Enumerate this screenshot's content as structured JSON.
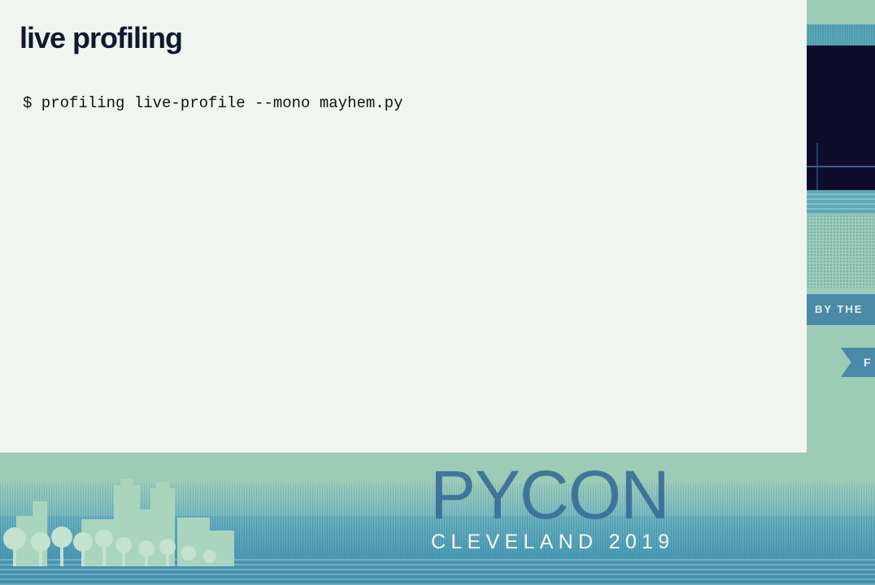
{
  "slide": {
    "title": "live profiling",
    "command": "$ profiling live-profile --mono mayhem.py"
  },
  "backdrop": {
    "side_ribbon_text": "BY THE",
    "side_tag_text": "F",
    "logo_word": "PYCON",
    "logo_subtitle": "CLEVELAND 2019"
  },
  "colors": {
    "slide_background": "#f1f5f0",
    "title_text": "#10192e",
    "backdrop_mint": "#9ccbb6",
    "backdrop_teal": "#4a98b3",
    "logo_blue": "#3a6e98",
    "video_navy": "#0e0c2b"
  }
}
